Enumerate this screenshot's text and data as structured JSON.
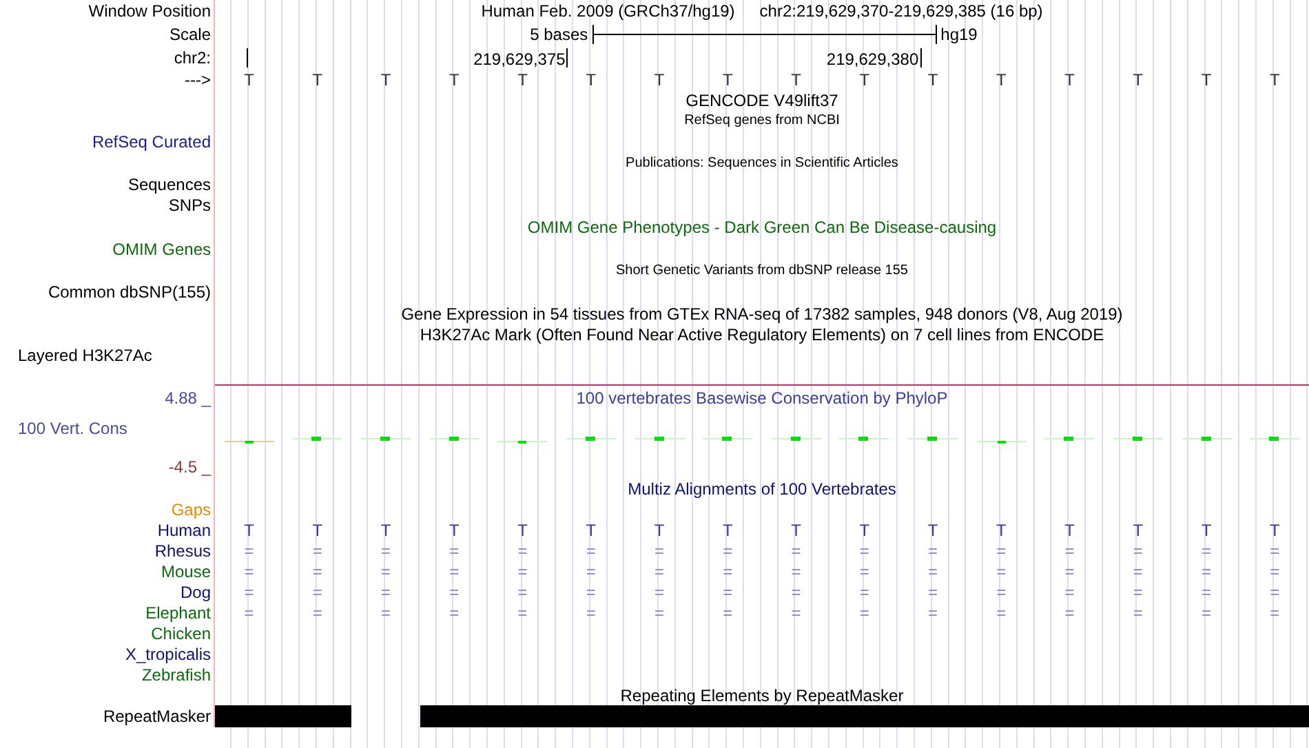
{
  "header": {
    "position_label": "Window Position",
    "assembly": "Human Feb. 2009 (GRCh37/hg19)",
    "position": "chr2:219,629,370-219,629,385 (16 bp)"
  },
  "scale": {
    "label": "Scale",
    "text": "5 bases",
    "assembly": "hg19"
  },
  "ruler": {
    "label": "chr2:",
    "tick_labels": [
      "219,629,375",
      "219,629,380"
    ]
  },
  "sequence": {
    "label": "--->",
    "bases": [
      "T",
      "T",
      "T",
      "T",
      "T",
      "T",
      "T",
      "T",
      "T",
      "T",
      "T",
      "T",
      "T",
      "T",
      "T",
      "T"
    ]
  },
  "tracks": [
    {
      "kind": "title",
      "text": "GENCODE V49lift37",
      "color": "#000000"
    },
    {
      "kind": "subtitle",
      "text": "RefSeq genes from NCBI",
      "color": "#000000"
    },
    {
      "kind": "label",
      "text": "RefSeq Curated",
      "color": "#1c1c8a"
    },
    {
      "kind": "subtitle",
      "text": "Publications: Sequences in Scientific Articles",
      "color": "#000000"
    },
    {
      "kind": "label",
      "text": "Sequences",
      "color": "#000000"
    },
    {
      "kind": "label",
      "text": "SNPs",
      "color": "#000000"
    },
    {
      "kind": "title",
      "text": "OMIM Gene Phenotypes - Dark Green Can Be Disease-causing",
      "color": "#0b6b0b"
    },
    {
      "kind": "label",
      "text": "OMIM Genes",
      "color": "#0b6b0b"
    },
    {
      "kind": "subtitle",
      "text": "Short Genetic Variants from dbSNP release 155",
      "color": "#000000"
    },
    {
      "kind": "label",
      "text": "Common dbSNP(155)",
      "color": "#000000"
    },
    {
      "kind": "title",
      "text": "Gene Expression in 54 tissues from GTEx RNA-seq of 17382 samples, 948 donors (V8, Aug 2019)",
      "color": "#000000"
    },
    {
      "kind": "title",
      "text": "H3K27Ac Mark (Often Found Near Active Regulatory Elements) on 7 cell lines from ENCODE",
      "color": "#000000"
    },
    {
      "kind": "label_left",
      "text": "Layered H3K27Ac",
      "color": "#000000"
    }
  ],
  "conservation": {
    "title": "100 vertebrates Basewise Conservation by PhyloP",
    "max": "4.88 _",
    "label": "100 Vert. Cons",
    "min": "-4.5 _"
  },
  "multiz": {
    "title": "Multiz Alignments of 100 Vertebrates",
    "species": [
      {
        "name": "Gaps",
        "color": "#e68a00"
      },
      {
        "name": "Human",
        "color": "#12126e",
        "bases": [
          "T",
          "T",
          "T",
          "T",
          "T",
          "T",
          "T",
          "T",
          "T",
          "T",
          "T",
          "T",
          "T",
          "T",
          "T",
          "T"
        ]
      },
      {
        "name": "Rhesus",
        "color": "#12126e",
        "bases": [
          "=",
          "=",
          "=",
          "=",
          "=",
          "=",
          "=",
          "=",
          "=",
          "=",
          "=",
          "=",
          "=",
          "=",
          "=",
          "="
        ]
      },
      {
        "name": "Mouse",
        "color": "#0b6b0b",
        "bases": [
          "=",
          "=",
          "=",
          "=",
          "=",
          "=",
          "=",
          "=",
          "=",
          "=",
          "=",
          "=",
          "=",
          "=",
          "=",
          "="
        ]
      },
      {
        "name": "Dog",
        "color": "#12126e",
        "bases": [
          "=",
          "=",
          "=",
          "=",
          "=",
          "=",
          "=",
          "=",
          "=",
          "=",
          "=",
          "=",
          "=",
          "=",
          "=",
          "="
        ]
      },
      {
        "name": "Elephant",
        "color": "#0b6b0b",
        "bases": [
          "=",
          "=",
          "=",
          "=",
          "=",
          "=",
          "=",
          "=",
          "=",
          "=",
          "=",
          "=",
          "=",
          "=",
          "=",
          "="
        ]
      },
      {
        "name": "Chicken",
        "color": "#0b6b0b"
      },
      {
        "name": "X_tropicalis",
        "color": "#12126e"
      },
      {
        "name": "Zebrafish",
        "color": "#0b6b0b"
      }
    ]
  },
  "repeats": {
    "title": "Repeating Elements by RepeatMasker",
    "label": "RepeatMasker",
    "segments": [
      {
        "covered": true
      },
      {
        "covered": true
      },
      {
        "covered": false
      },
      {
        "covered": true
      },
      {
        "covered": true
      },
      {
        "covered": true
      },
      {
        "covered": true
      },
      {
        "covered": true
      },
      {
        "covered": true
      },
      {
        "covered": true
      },
      {
        "covered": true
      },
      {
        "covered": true
      },
      {
        "covered": true
      },
      {
        "covered": true
      },
      {
        "covered": true
      },
      {
        "covered": true
      }
    ]
  }
}
